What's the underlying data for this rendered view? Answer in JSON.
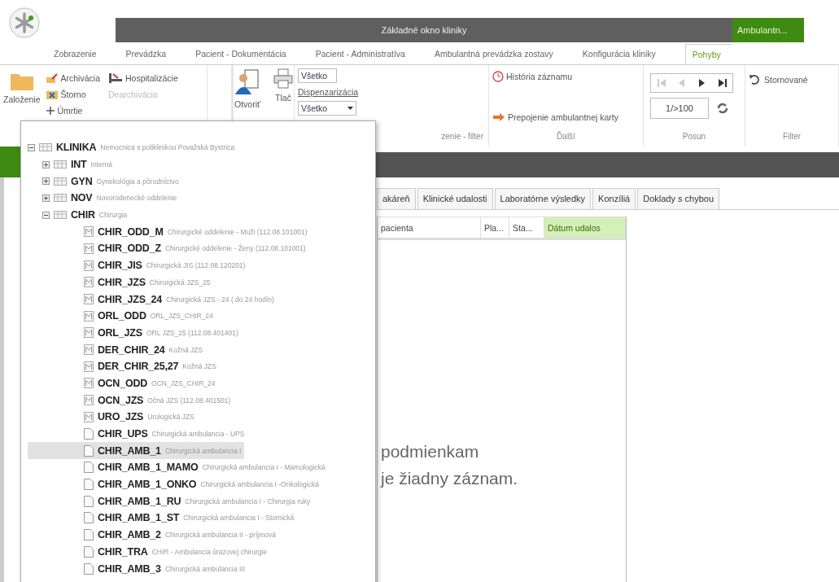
{
  "app": {
    "title": "Základné okno kliniky",
    "context_tab": "Ambulantn..."
  },
  "ribbon_tabs": [
    {
      "label": "Zobrazenie",
      "selected": false
    },
    {
      "label": "Prevádzka",
      "selected": false
    },
    {
      "label": "Pacient - Dokumentácia",
      "selected": false
    },
    {
      "label": "Pacient - Administratíva",
      "selected": false
    },
    {
      "label": "Ambulantná prevádzka zostavy",
      "selected": false
    },
    {
      "label": "Konfigurácia kliniky",
      "selected": false
    },
    {
      "label": "Pohyby",
      "selected": true
    }
  ],
  "ribbon": {
    "create_button": "Založenie",
    "record_actions": [
      {
        "label": "Archivácia",
        "kind": "archive",
        "disabled": false
      },
      {
        "label": "Hospitalizácie",
        "kind": "hospital",
        "disabled": false
      },
      {
        "label": "Štorno",
        "kind": "cancel",
        "disabled": false
      },
      {
        "label": "Dearchivácia",
        "kind": "plain",
        "disabled": true
      },
      {
        "label": "Úmrtie",
        "kind": "plus",
        "disabled": false
      }
    ],
    "open_button": "Otvoriť",
    "print_button": "Tlač",
    "filter": {
      "value": "Všetko",
      "dispensary_label": "Dispenzarizácia",
      "dispensary_value": "Všetko",
      "group_label": "zenie - filter"
    },
    "more": {
      "actions": [
        {
          "label": "História záznamu",
          "kind": "history"
        },
        {
          "label": "Prepojenie ambulantnej karty",
          "kind": "link"
        }
      ],
      "group_label": "Ďalší"
    },
    "paging": {
      "nav_buttons": [
        {
          "kind": "first",
          "disabled": true
        },
        {
          "kind": "prev",
          "disabled": true
        },
        {
          "kind": "next",
          "disabled": false
        },
        {
          "kind": "last",
          "disabled": false
        }
      ],
      "page": "1/>100",
      "group_label": "Posun"
    },
    "filters": {
      "cancelled_button": "Stornované",
      "group_label": "Filter"
    }
  },
  "detail_tabs": [
    {
      "label": "akáreň",
      "selected": false
    },
    {
      "label": "Klinické udalosti",
      "selected": false
    },
    {
      "label": "Laboratórne výsledky",
      "selected": false
    },
    {
      "label": "Konzíliá",
      "selected": false
    },
    {
      "label": "Doklady s chybou",
      "selected": false
    }
  ],
  "table": {
    "columns": [
      {
        "label": "pacienta",
        "sorted": false
      },
      {
        "label": "Pla...",
        "sorted": false
      },
      {
        "label": "Sta...",
        "sorted": false
      },
      {
        "label": "Dátum udalos",
        "sorted": true
      }
    ],
    "empty_message": [
      "podmienkam",
      "je žiadny záznam."
    ]
  },
  "tree": [
    {
      "code": "KLINIKA",
      "description": "Nemocnica s poliklinikou Považská Bystrica",
      "kind": "facility",
      "expanded": true,
      "selected": false,
      "children": [
        {
          "code": "INT",
          "description": "Interná",
          "kind": "department",
          "expanded": false,
          "selected": false
        },
        {
          "code": "GYN",
          "description": "Gynekológia a pôrodníctvo",
          "kind": "department",
          "expanded": false,
          "selected": false
        },
        {
          "code": "NOV",
          "description": "Novorodenecké oddelenie",
          "kind": "department",
          "expanded": false,
          "selected": false
        },
        {
          "code": "CHIR",
          "description": "Chirurgia",
          "kind": "department",
          "expanded": true,
          "selected": false,
          "children": [
            {
              "code": "CHIR_ODD_M",
              "description": "Chirurgické oddelenie - Muži (112.08.101001)",
              "kind": "ward",
              "selected": false
            },
            {
              "code": "CHIR_ODD_Z",
              "description": "Chirurgické oddelenie - Ženy (112.08.101001)",
              "kind": "ward",
              "selected": false
            },
            {
              "code": "CHIR_JIS",
              "description": "Chirurgická JIS (112.08.120201)",
              "kind": "ward",
              "selected": false
            },
            {
              "code": "CHIR_JZS",
              "description": "Chirurgická JZS_25",
              "kind": "ward",
              "selected": false
            },
            {
              "code": "CHIR_JZS_24",
              "description": "Chirurgická JZS - 24 ( do 24 hodín)",
              "kind": "ward",
              "selected": false
            },
            {
              "code": "ORL_ODD",
              "description": "ORL_JZS_CHIR_24",
              "kind": "ward",
              "selected": false
            },
            {
              "code": "ORL_JZS",
              "description": "ORL JZS_25 (112.08.401401)",
              "kind": "ward",
              "selected": false
            },
            {
              "code": "DER_CHIR_24",
              "description": "Kožná JZS",
              "kind": "ward",
              "selected": false
            },
            {
              "code": "DER_CHIR_25,27",
              "description": "Kožná JZS",
              "kind": "ward",
              "selected": false
            },
            {
              "code": "OCN_ODD",
              "description": "OCN_JZS_CHIR_24",
              "kind": "ward",
              "selected": false
            },
            {
              "code": "OCN_JZS",
              "description": "Očná JZS (112.08.401501)",
              "kind": "ward",
              "selected": false
            },
            {
              "code": "URO_JZS",
              "description": "Urologická JZS",
              "kind": "ward",
              "selected": false
            },
            {
              "code": "CHIR_UPS",
              "description": "Chirurgická ambulancia - UPS",
              "kind": "clinic",
              "selected": false
            },
            {
              "code": "CHIR_AMB_1",
              "description": "Chirurgická ambulancia I",
              "kind": "clinic",
              "selected": true
            },
            {
              "code": "CHIR_AMB_1_MAMO",
              "description": "Chirurgická ambulancia I - Mamologická",
              "kind": "clinic",
              "selected": false
            },
            {
              "code": "CHIR_AMB_1_ONKO",
              "description": "Chirurgická ambulancia I -Onkologická",
              "kind": "clinic",
              "selected": false
            },
            {
              "code": "CHIR_AMB_1_RU",
              "description": "Chirurgická ambulancia I - Chirurgia ruky",
              "kind": "clinic",
              "selected": false
            },
            {
              "code": "CHIR_AMB_1_ST",
              "description": "Chirurgická ambulancia I - Stomická",
              "kind": "clinic",
              "selected": false
            },
            {
              "code": "CHIR_AMB_2",
              "description": "Chirurgická ambulancia II - príjmová",
              "kind": "clinic",
              "selected": false
            },
            {
              "code": "CHIR_TRA",
              "description": "CHIR - Ambulancia úrazovej chirurgie",
              "kind": "clinic",
              "selected": false
            },
            {
              "code": "CHIR_AMB_3",
              "description": "Chirurgická ambulancia III",
              "kind": "clinic",
              "selected": false
            }
          ]
        }
      ]
    }
  ]
}
